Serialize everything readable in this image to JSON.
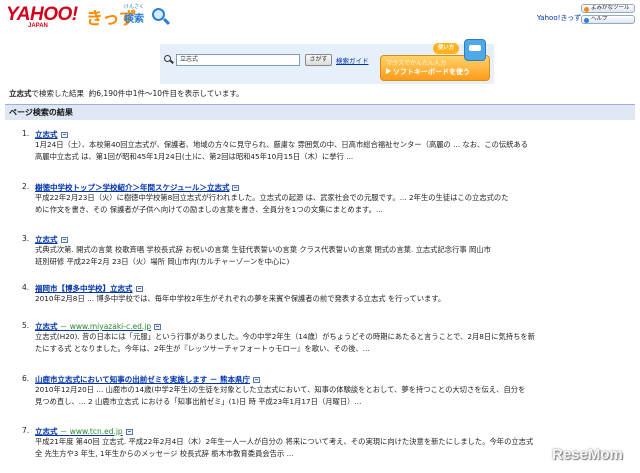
{
  "header": {
    "logo_yahoo": "YAHOO!",
    "logo_japan": "JAPAN",
    "logo_kids": "きっず",
    "logo_kensaku": "検索",
    "logo_ruby": "けんさく",
    "yahoo_kids_link": "Yahoo!きっず",
    "tool_button": "よみがなツール",
    "help_button": "ヘルプ"
  },
  "search": {
    "query": "立志式",
    "button_label": "さがす",
    "guide_link": "検索ガイド",
    "keyboard_tag": "使い方",
    "keyboard_sub": "マウスでかんたん入力",
    "keyboard_main": "ソフトキーボードを使う"
  },
  "summary": {
    "keyword": "立志式",
    "text_prefix": "で検索した結果",
    "count_text": "約6,190件中1件〜10件目を表示しています。"
  },
  "section_title": "ページ検索の結果",
  "results": [
    {
      "num": "1.",
      "title": "立志式",
      "url": "",
      "lines": [
        "1月24日（土）、本校第40回立志式が、保護者、地域の方々に見守られ、厳粛な 雰囲気の中、日高市総合福祉センター（高麗の ... なお、この伝統ある",
        "高麗中立志式 は、第1回が昭和45年1月24日(土)に、第2回は昭和45年10月15日（木）に挙行 ..."
      ]
    },
    {
      "num": "2.",
      "title": "樹徳中学校トップ＞学校紹介＞年間スケジュール＞立志式",
      "url": "",
      "lines": [
        "平成22年2月23日（火）に樹徳中学校第8回立志式が行われました。立志式の起源 は、武家社会での元服です。... 2年生の生徒はこの立志式のた",
        "めに作文を書き、その 保護者が子供へ向けての励ましの言葉を書き、全員分を1つの文集にまとめます。..."
      ]
    },
    {
      "num": "3.",
      "title": "立志式",
      "url": "",
      "lines": [
        "式典式次第. 開式の言葉 校歌斉唱 学校長式辞 お祝いの言葉 生徒代表誓いの言葉 クラス代表誓いの言葉 閉式の言葉. 立志式記念行事 岡山市",
        "班別研修 平成22年2月 23日（火）場所 岡山市内(カルチャーゾーンを中心に)"
      ]
    },
    {
      "num": "4.",
      "title": "福岡市【博多中学校】立志式",
      "url": "",
      "lines": [
        "2010年2月8日 ... 博多中学校では、毎年中学校2年生がそれぞれの夢を来賓や保護者の前で発表する立志式 を行っています。"
      ]
    },
    {
      "num": "5.",
      "title": "立志式",
      "url": "www.miyazaki-c.ed.jp",
      "lines": [
        "立志式(H20). 昔の日本には「元服」という行事がありました。今の中学2年生（14歳）がちょうどその時期にあたると言うことで、2月8日に気持ちを新",
        "たにする式 となりました。今年は、2年生が『レッツサーチャフォートゥモロー』を歌い、その後、..."
      ]
    },
    {
      "num": "6.",
      "title": "山鹿市立志式において知事の出前ゼミを実施します － 熊本県庁",
      "url": "",
      "lines": [
        "2010年12月20日 ... 山鹿市の14歳(中学2年生)の生徒を対象とした立志式において、知事の体験談をとおして、夢を持つことの大切さを伝え、自分を",
        "見つめ直し、... 2 山鹿市立志式 における「知事出前ゼミ」(1)日 時 平成23年1月17日（月曜日）..."
      ]
    },
    {
      "num": "7.",
      "title": "立志式",
      "url": "www.tcn.ed.jp",
      "lines": [
        "平成21年度 第40回 立志式. 平成22年2月4日（木）2年生一人一人が自分の 将来について考え、その実現に向けた決意を新たにしました。今年の立志式",
        "全 先生方や3 年生, 1年生からのメッセージ 校長式辞 栃木市教育委員会告示 ..."
      ]
    }
  ],
  "watermark": "ReseMom"
}
